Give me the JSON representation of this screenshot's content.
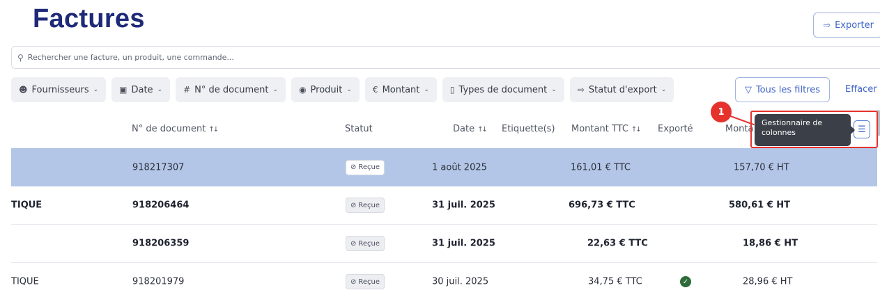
{
  "page": {
    "title": "Factures"
  },
  "header": {
    "export_label": "Exporter",
    "export_icon": "export-icon"
  },
  "search": {
    "placeholder": "Rechercher une facture, un produit, une commande..."
  },
  "filters": [
    {
      "label": "Fournisseurs",
      "icon": "person-icon"
    },
    {
      "label": "Date",
      "icon": "calendar-icon"
    },
    {
      "label": "N° de document",
      "icon": "hash-icon"
    },
    {
      "label": "Produit",
      "icon": "product-icon"
    },
    {
      "label": "Montant",
      "icon": "euro-icon"
    },
    {
      "label": "Types de document",
      "icon": "document-icon"
    },
    {
      "label": "Statut d'export",
      "icon": "export-icon"
    }
  ],
  "all_filters_label": "Tous les filtres",
  "clear_label": "Effacer",
  "columns": {
    "doc_number": "N° de document",
    "status": "Statut",
    "date": "Date",
    "labels": "Etiquette(s)",
    "amount_ttc": "Montant TTC",
    "exported": "Exporté",
    "amount_ht": "Monta"
  },
  "tooltip": {
    "text": "Gestionnaire de colonnes"
  },
  "annotation": {
    "step": "1"
  },
  "rows": [
    {
      "supplier": "",
      "doc_number": "918217307",
      "status": "Reçue",
      "date": "1 août 2025",
      "labels": "",
      "amount_ttc": "161,01 € TTC",
      "exported": false,
      "amount_ht": "157,70 € HT",
      "selected": true,
      "bold": false
    },
    {
      "supplier": "TIQUE",
      "doc_number": "918206464",
      "status": "Reçue",
      "date": "31 juil. 2025",
      "labels": "",
      "amount_ttc": "696,73 € TTC",
      "exported": false,
      "amount_ht": "580,61 € HT",
      "selected": false,
      "bold": true
    },
    {
      "supplier": "",
      "doc_number": "918206359",
      "status": "Reçue",
      "date": "31 juil. 2025",
      "labels": "",
      "amount_ttc": "22,63 € TTC",
      "exported": false,
      "amount_ht": "18,86 € HT",
      "selected": false,
      "bold": true
    },
    {
      "supplier": "TIQUE",
      "doc_number": "918201979",
      "status": "Reçue",
      "date": "30 juil. 2025",
      "labels": "",
      "amount_ttc": "34,75 € TTC",
      "exported": true,
      "amount_ht": "28,96 € HT",
      "selected": false,
      "bold": false
    }
  ],
  "colors": {
    "primary": "#1e2a78",
    "accent": "#3e63c9",
    "selected_row": "#b4c6e7",
    "annotation": "#e5322d",
    "exported_check": "#2e6b3a"
  }
}
